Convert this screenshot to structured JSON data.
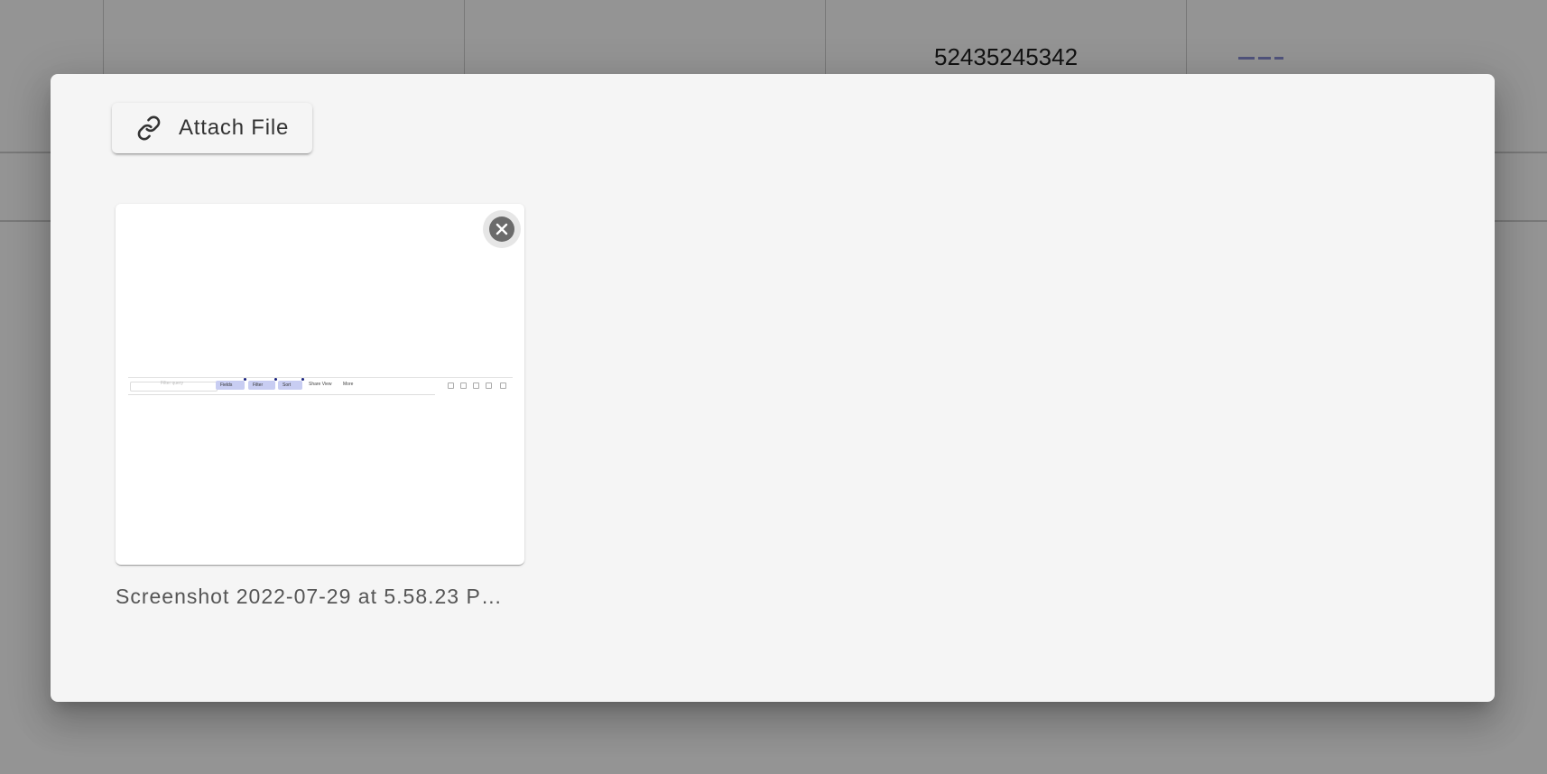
{
  "background": {
    "cell_value": "52435245342"
  },
  "dialog": {
    "attach_button": {
      "label": "Attach File",
      "icon": "link-icon"
    },
    "attachments": [
      {
        "file_name": "Screenshot 2022-07-29 at 5.58.23 P…",
        "remove_icon": "close-circle-icon",
        "preview": {
          "search_placeholder": "Filter query",
          "chips": [
            "Fields",
            "Filter",
            "Sort"
          ],
          "share_view": "Share View",
          "more": "More"
        }
      }
    ]
  },
  "colors": {
    "overlay": "rgba(0,0,0,0.42)",
    "dialog_bg": "#f5f5f5",
    "chip_bg": "#c8cdf2",
    "remove_icon_bg": "#6b6b6b"
  }
}
